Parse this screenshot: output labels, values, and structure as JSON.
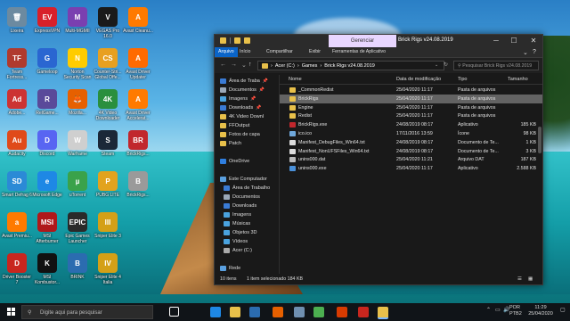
{
  "desktop_icons": [
    {
      "label": "Lixeira",
      "color": "#6c8aa0",
      "glyph": "🗑"
    },
    {
      "label": "ExpressVPN",
      "color": "#d8202a",
      "glyph": "EV"
    },
    {
      "label": "Multi-MGMII",
      "color": "#7a3fb0",
      "glyph": "M"
    },
    {
      "label": "VEGAS Pro 16.0",
      "color": "#1a1a1a",
      "glyph": "V"
    },
    {
      "label": "Avast Cleanu...",
      "color": "#ff7a00",
      "glyph": "A"
    },
    {
      "label": "Team Fortress...",
      "color": "#b03a2e",
      "glyph": "TF"
    },
    {
      "label": "Gameloop",
      "color": "#2a66d1",
      "glyph": "G"
    },
    {
      "label": "Norton Security Scan",
      "color": "#ffcc00",
      "glyph": "N"
    },
    {
      "label": "Counter-Stri... Global Offe...",
      "color": "#e8a020",
      "glyph": "CS"
    },
    {
      "label": "Avast Driver Updater",
      "color": "#ff6a00",
      "glyph": "A"
    },
    {
      "label": "Adobe...",
      "color": "#c33",
      "glyph": "Ad"
    },
    {
      "label": "RelGame...",
      "color": "#5a4a9a",
      "glyph": "R"
    },
    {
      "label": "Mozilla...",
      "color": "#e66000",
      "glyph": "🦊"
    },
    {
      "label": "4K Video Downloader",
      "color": "#2a8f3d",
      "glyph": "4K"
    },
    {
      "label": "Avast Driver Accelerat...",
      "color": "#ff7a00",
      "glyph": "A"
    },
    {
      "label": "Audacity",
      "color": "#e04a1a",
      "glyph": "Au"
    },
    {
      "label": "Discord",
      "color": "#5865f2",
      "glyph": "D"
    },
    {
      "label": "Warframe",
      "color": "#cfcfcf",
      "glyph": "W"
    },
    {
      "label": "Steam",
      "color": "#1b2838",
      "glyph": "S"
    },
    {
      "label": "BrickRigs...",
      "color": "#c1272d",
      "glyph": "BR"
    },
    {
      "label": "Smart Defrag 6",
      "color": "#2b8ad6",
      "glyph": "SD"
    },
    {
      "label": "Microsoft Edge",
      "color": "#1e88e5",
      "glyph": "e"
    },
    {
      "label": "uTorrent",
      "color": "#3aa24a",
      "glyph": "µ"
    },
    {
      "label": "PUBG LITE",
      "color": "#e2a31e",
      "glyph": "P"
    },
    {
      "label": "BrickRigs...",
      "color": "#9a9a9a",
      "glyph": "B"
    },
    {
      "label": "Avast Premiu...",
      "color": "#ff7a00",
      "glyph": "a"
    },
    {
      "label": "MSI Afterburner",
      "color": "#b0181a",
      "glyph": "MSI"
    },
    {
      "label": "Epic Games Launcher",
      "color": "#2a2a2a",
      "glyph": "EPIC"
    },
    {
      "label": "Sniper Elite 3",
      "color": "#d4a017",
      "glyph": "III"
    },
    {
      "label": "",
      "color": "transparent",
      "glyph": ""
    },
    {
      "label": "Driver Booster 7",
      "color": "#c8261e",
      "glyph": "D"
    },
    {
      "label": "MSI Kombustor...",
      "color": "#111",
      "glyph": "K"
    },
    {
      "label": "BRINK",
      "color": "#2b6cb0",
      "glyph": "B"
    },
    {
      "label": "Sniper Elite 4 Italia",
      "color": "#d4a017",
      "glyph": "IV"
    }
  ],
  "window": {
    "manage_tab": "Gerenciar",
    "title": "Brick Rigs v24.08.2019",
    "ribbon_tabs": [
      "Arquivo",
      "Início",
      "Compartilhar",
      "Exibir",
      "Ferramentas de Aplicativo"
    ],
    "breadcrumb": [
      "Acer (C:)",
      "Games",
      "Brick Rigs v24.08.2019"
    ],
    "search_placeholder": "Pesquisar Brick Rigs v24.08.2019",
    "columns": {
      "name": "Nome",
      "date": "Data de modificação",
      "type": "Tipo",
      "size": "Tamanho"
    },
    "nav": [
      {
        "label": "Área de Traba",
        "color": "#3a7bd5",
        "pin": true
      },
      {
        "label": "Documentos",
        "color": "#9aa8b8",
        "pin": true
      },
      {
        "label": "Imagens",
        "color": "#4aa3df",
        "pin": true
      },
      {
        "label": "Downloads",
        "color": "#3a7bd5",
        "pin": true
      },
      {
        "label": "4K Video Downl",
        "color": "#e8c04a",
        "pin": false
      },
      {
        "label": "FFOutput",
        "color": "#e8c04a",
        "pin": false
      },
      {
        "label": "Fotos de capa",
        "color": "#e8c04a",
        "pin": false
      },
      {
        "label": "Patch",
        "color": "#e8c04a",
        "pin": false
      },
      {
        "label": "",
        "color": "transparent",
        "pin": false
      },
      {
        "label": "OneDrive",
        "color": "#2f7fe0",
        "pin": false
      },
      {
        "label": "",
        "color": "transparent",
        "pin": false
      },
      {
        "label": "Este Computador",
        "color": "#5aa0e0",
        "pin": false
      },
      {
        "label": "Área de Trabalho",
        "color": "#3a7bd5",
        "pin": false
      },
      {
        "label": "Documentos",
        "color": "#9aa8b8",
        "pin": false
      },
      {
        "label": "Downloads",
        "color": "#3a7bd5",
        "pin": false
      },
      {
        "label": "Imagens",
        "color": "#4aa3df",
        "pin": false
      },
      {
        "label": "Músicas",
        "color": "#4aa3df",
        "pin": false
      },
      {
        "label": "Objetos 3D",
        "color": "#4aa3df",
        "pin": false
      },
      {
        "label": "Vídeos",
        "color": "#4aa3df",
        "pin": false
      },
      {
        "label": "Acer (C:)",
        "color": "#aaaaaa",
        "pin": false
      },
      {
        "label": "",
        "color": "transparent",
        "pin": false
      },
      {
        "label": "Rede",
        "color": "#5aa0e0",
        "pin": false
      }
    ],
    "files": [
      {
        "name": "_CommonRedist",
        "date": "25/04/2020 11:17",
        "type": "Pasta de arquivos",
        "size": "",
        "icon": "#e8c04a",
        "selected": false
      },
      {
        "name": "BrickRigs",
        "date": "25/04/2020 11:17",
        "type": "Pasta de arquivos",
        "size": "",
        "icon": "#e8c04a",
        "selected": true
      },
      {
        "name": "Engine",
        "date": "25/04/2020 11:17",
        "type": "Pasta de arquivos",
        "size": "",
        "icon": "#e8c04a",
        "selected": false
      },
      {
        "name": "Redist",
        "date": "25/04/2020 11:17",
        "type": "Pasta de arquivos",
        "size": "",
        "icon": "#e8c04a",
        "selected": false
      },
      {
        "name": "BrickRigs.exe",
        "date": "24/08/2019 08:17",
        "type": "Aplicativo",
        "size": "185 KB",
        "icon": "#c1272d",
        "selected": false
      },
      {
        "name": "ico.ico",
        "date": "17/11/2016 13:59",
        "type": "Ícone",
        "size": "98 KB",
        "icon": "#6fa8dc",
        "selected": false
      },
      {
        "name": "Manifest_DebugFiles_Win64.txt",
        "date": "24/08/2019 08:17",
        "type": "Documento de Te...",
        "size": "1 KB",
        "icon": "#dddddd",
        "selected": false
      },
      {
        "name": "Manifest_NonUFSFiles_Win64.txt",
        "date": "24/08/2019 08:17",
        "type": "Documento de Te...",
        "size": "3 KB",
        "icon": "#dddddd",
        "selected": false
      },
      {
        "name": "unins000.dat",
        "date": "25/04/2020 11:21",
        "type": "Arquivo DAT",
        "size": "187 KB",
        "icon": "#bbbbbb",
        "selected": false
      },
      {
        "name": "unins000.exe",
        "date": "25/04/2020 11:17",
        "type": "Aplicativo",
        "size": "2.588 KB",
        "icon": "#4a90d9",
        "selected": false
      }
    ],
    "status_count": "10 itens",
    "status_selected": "1 item selecionado  184 KB"
  },
  "taskbar": {
    "search_placeholder": "Digite aqui para pesquisar",
    "apps": [
      {
        "name": "task-view",
        "color": "#ffffff"
      },
      {
        "name": "edge",
        "color": "#1e88e5"
      },
      {
        "name": "explorer",
        "color": "#e8c04a"
      },
      {
        "name": "store",
        "color": "#2b6cb0"
      },
      {
        "name": "firefox",
        "color": "#e66000"
      },
      {
        "name": "steam",
        "color": "#6f8fb0"
      },
      {
        "name": "chrome",
        "color": "#4caf50"
      },
      {
        "name": "office",
        "color": "#d83b01"
      },
      {
        "name": "vegas",
        "color": "#c8261e"
      },
      {
        "name": "explorer-active",
        "color": "#e8c04a"
      }
    ],
    "lang": "POR",
    "kb": "PTB2",
    "time": "11:29",
    "date": "25/04/2020"
  }
}
